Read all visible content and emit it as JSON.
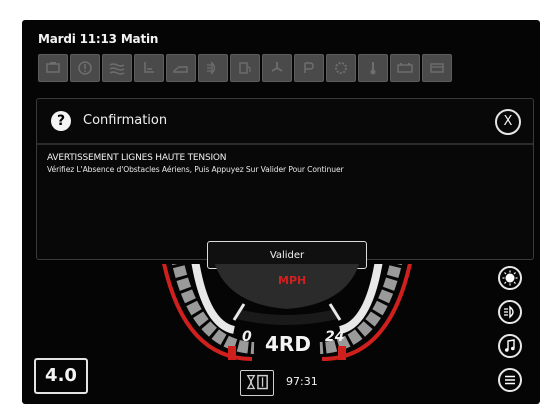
{
  "status": {
    "datetime": "Mardi 11:13 Matin"
  },
  "indicators": [
    {
      "icon": "engine-icon"
    },
    {
      "icon": "warning-circle-icon"
    },
    {
      "icon": "coolant-icon"
    },
    {
      "icon": "seat-icon"
    },
    {
      "icon": "oil-icon"
    },
    {
      "icon": "headlight-icon"
    },
    {
      "icon": "fuel-icon"
    },
    {
      "icon": "fan-icon"
    },
    {
      "icon": "parking-icon"
    },
    {
      "icon": "gear-warning-icon"
    },
    {
      "icon": "temperature-icon"
    },
    {
      "icon": "battery-icon"
    },
    {
      "icon": "service-icon"
    }
  ],
  "dialog": {
    "title": "Confirmation",
    "close_label": "X",
    "warning_title": "AVERTISSEMENT LIGNES HAUTE TENSION",
    "warning_body": "Vérifiez L'Absence d'Obstacles Aériens, Puis Appuyez Sur Valider Pour Continuer",
    "confirm_label": "Valider"
  },
  "gauge": {
    "unit": "MPH",
    "scale_min": "0",
    "scale_max": "24",
    "gear": "4RD",
    "accent_color": "#d0201e"
  },
  "speed": {
    "value": "4.0"
  },
  "hours": {
    "value": "97:31"
  },
  "right_buttons": [
    {
      "icon": "work-light-icon"
    },
    {
      "icon": "headlight-icon"
    },
    {
      "icon": "music-icon"
    },
    {
      "icon": "menu-icon"
    }
  ]
}
